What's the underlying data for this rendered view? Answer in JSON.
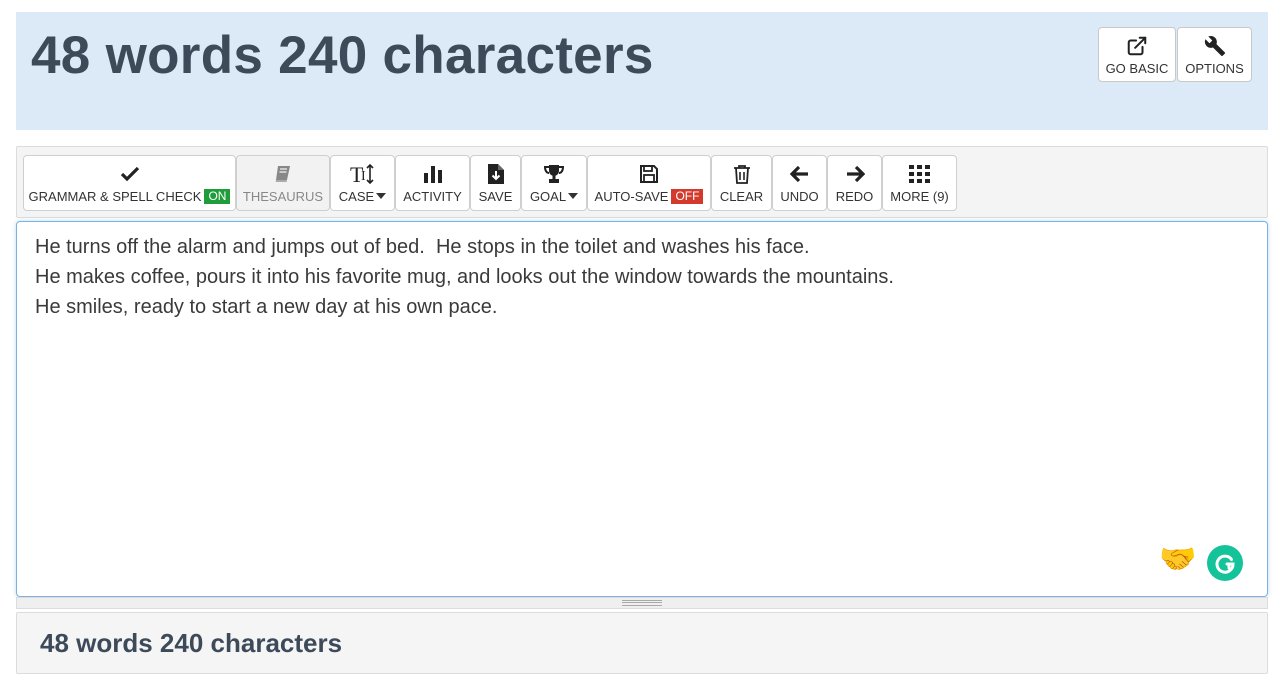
{
  "header": {
    "title": "48 words 240 characters",
    "go_basic_label": "GO BASIC",
    "options_label": "OPTIONS"
  },
  "toolbar": {
    "grammar_label": "GRAMMAR & SPELL CHECK",
    "grammar_badge": "ON",
    "thesaurus_label": "THESAURUS",
    "case_label": "CASE",
    "activity_label": "ACTIVITY",
    "save_label": "SAVE",
    "goal_label": "GOAL",
    "autosave_label": "AUTO-SAVE",
    "autosave_badge": "OFF",
    "clear_label": "CLEAR",
    "undo_label": "UNDO",
    "redo_label": "REDO",
    "more_label": "MORE (9)"
  },
  "editor": {
    "lines": [
      "He turns off the alarm and jumps out of bed.  He stops in the toilet and washes his face.",
      "He makes coffee, pours it into his favorite mug, and looks out the window towards the mountains.",
      "He smiles, ready to start a new day at his own pace."
    ],
    "handshake_emoji": "🤝"
  },
  "footer": {
    "count": "48 words 240 characters"
  },
  "colors": {
    "header_bg": "#dbeaf6",
    "title_color": "#3d4a59",
    "on_badge": "#1f9d3a",
    "off_badge": "#d33a2c",
    "grammarly": "#15c39a",
    "editor_focus": "#7fb1df"
  },
  "icons": {
    "go_basic": "external-link-icon",
    "options": "wrench-icon",
    "grammar": "check-icon",
    "thesaurus": "book-icon",
    "case": "text-height-icon",
    "activity": "bar-chart-icon",
    "save": "file-download-icon",
    "goal": "trophy-icon",
    "autosave": "floppy-disk-icon",
    "clear": "trash-icon",
    "undo": "arrow-left-icon",
    "redo": "arrow-right-icon",
    "more": "grid-icon",
    "grammarly": "grammarly-icon"
  }
}
